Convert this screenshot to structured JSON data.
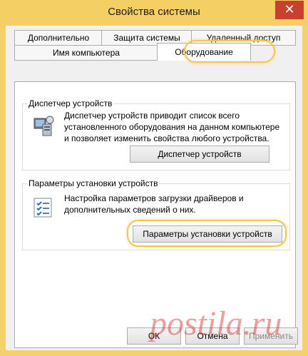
{
  "window": {
    "title": "Свойства системы",
    "close": "✕"
  },
  "tabs": {
    "advanced": "Дополнительно",
    "protection": "Защита системы",
    "remote": "Удаленный доступ",
    "computer_name": "Имя компьютера",
    "hardware": "Оборудование"
  },
  "device_manager": {
    "title": "Диспетчер устройств",
    "description": "Диспетчер устройств приводит список всего установленного оборудования на данном компьютере и позволяет изменить свойства любого устройства.",
    "button": "Диспетчер устройств"
  },
  "install_settings": {
    "title": "Параметры установки устройств",
    "description": "Настройка параметров загрузки драйверов и дополнительных сведений о них.",
    "button": "Параметры установки устройств"
  },
  "footer": {
    "ok": "ОК",
    "cancel": "Отмена",
    "apply": "Применить"
  },
  "watermark": "postila.ru",
  "colors": {
    "title_bar": "#f4cf63",
    "close_button": "#c7412e",
    "highlight": "#f1c84e"
  }
}
